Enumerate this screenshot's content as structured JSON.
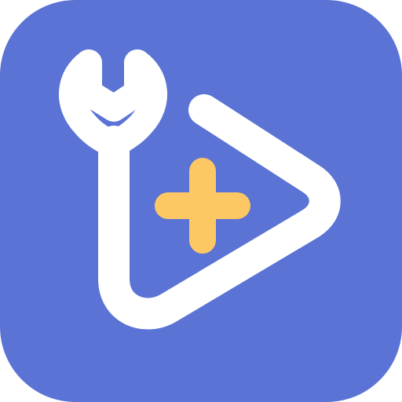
{
  "icon": {
    "name": "video-repair-app-icon",
    "colors": {
      "background": "#5A73D5",
      "stroke": "#FFFFFF",
      "plus": "#FDC764"
    },
    "parts": [
      "wrench-icon",
      "play-triangle-icon",
      "plus-icon"
    ]
  }
}
